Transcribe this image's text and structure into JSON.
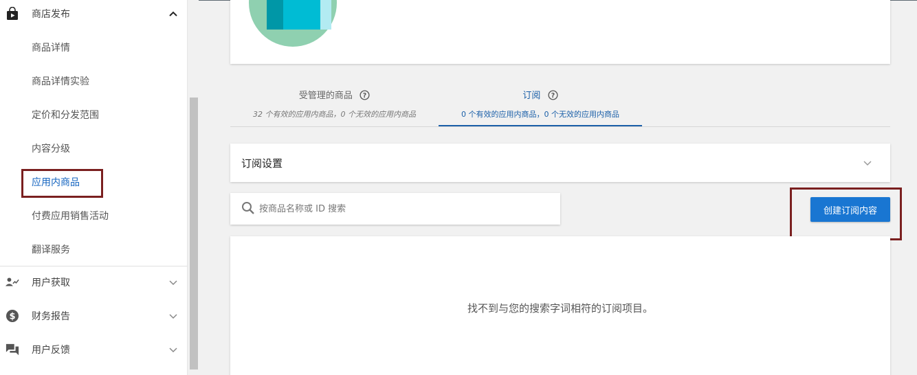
{
  "sidebar": {
    "store_section": {
      "label": "商店发布"
    },
    "store_items": [
      {
        "label": "商品详情"
      },
      {
        "label": "商品详情实验"
      },
      {
        "label": "定价和分发范围"
      },
      {
        "label": "内容分级"
      },
      {
        "label": "应用内商品"
      },
      {
        "label": "付费应用销售活动"
      },
      {
        "label": "翻译服务"
      }
    ],
    "other_sections": [
      {
        "label": "用户获取",
        "icon": "user-acquisition-icon"
      },
      {
        "label": "财务报告",
        "icon": "dollar-icon"
      },
      {
        "label": "用户反馈",
        "icon": "feedback-icon"
      }
    ]
  },
  "tabs": [
    {
      "title": "受管理的商品",
      "subtitle": "32 个有效的应用内商品，0 个无效的应用内商品"
    },
    {
      "title": "订阅",
      "subtitle": "0 个有效的应用内商品，0 个无效的应用内商品"
    }
  ],
  "settings": {
    "title": "订阅设置"
  },
  "search": {
    "placeholder": "按商品名称或 ID 搜索"
  },
  "create_button": {
    "label": "创建订阅内容"
  },
  "empty_state": {
    "message": "找不到与您的搜索字词相符的订阅项目。"
  },
  "colors": {
    "accent": "#1976d2",
    "highlight_box": "#7a1f1f",
    "active_tab": "#1a5fa8"
  }
}
